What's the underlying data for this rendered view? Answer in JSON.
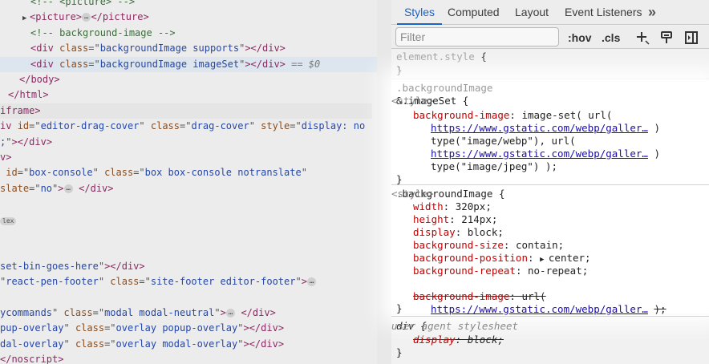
{
  "elements": {
    "lines": [
      {
        "indent": 38,
        "parts": [
          [
            "cmt",
            "<!-- <picture> -->"
          ]
        ]
      },
      {
        "indent": 28,
        "tri": true,
        "parts": [
          [
            "tag",
            "<picture>"
          ],
          [
            "ell",
            "…"
          ],
          [
            "tag",
            "</picture>"
          ]
        ]
      },
      {
        "indent": 38,
        "parts": [
          [
            "cmt",
            "<!-- background-image -->"
          ]
        ]
      },
      {
        "indent": 38,
        "parts": [
          [
            "tag",
            "<div "
          ],
          [
            "attr",
            "class"
          ],
          [
            "eq",
            "=\""
          ],
          [
            "val",
            "backgroundImage supports"
          ],
          [
            "eq",
            "\""
          ],
          [
            "tag",
            "></div>"
          ]
        ]
      },
      {
        "indent": 38,
        "selected": true,
        "parts": [
          [
            "tag",
            "<div "
          ],
          [
            "attr",
            "class"
          ],
          [
            "eq",
            "=\""
          ],
          [
            "val",
            "backgroundImage imageSet"
          ],
          [
            "eq",
            "\""
          ],
          [
            "tag",
            "></div>"
          ],
          [
            "dim",
            " == $0"
          ]
        ]
      },
      {
        "indent": 24,
        "parts": [
          [
            "tag",
            "</body>"
          ]
        ]
      },
      {
        "indent": 10,
        "parts": [
          [
            "tag",
            "</html>"
          ]
        ]
      },
      {
        "indent": 0,
        "tagbg": true,
        "parts": [
          [
            "tag",
            "iframe>"
          ]
        ]
      },
      {
        "indent": 0,
        "parts": [
          [
            "tag",
            "iv "
          ],
          [
            "attr",
            "id"
          ],
          [
            "eq",
            "=\""
          ],
          [
            "val",
            "editor-drag-cover"
          ],
          [
            "eq",
            "\" "
          ],
          [
            "attr",
            "class"
          ],
          [
            "eq",
            "=\""
          ],
          [
            "val",
            "drag-cover"
          ],
          [
            "eq",
            "\" "
          ],
          [
            "attr",
            "style"
          ],
          [
            "eq",
            "=\""
          ],
          [
            "val",
            "display: no"
          ]
        ]
      },
      {
        "indent": 0,
        "parts": [
          [
            "val",
            ";"
          ],
          [
            "eq",
            "\""
          ],
          [
            "tag",
            "></div>"
          ]
        ]
      },
      {
        "indent": 0,
        "parts": [
          [
            "tag",
            "v>"
          ]
        ]
      },
      {
        "indent": 0,
        "parts": [
          [
            "attr",
            " id"
          ],
          [
            "eq",
            "=\""
          ],
          [
            "val",
            "box-console"
          ],
          [
            "eq",
            "\" "
          ],
          [
            "attr",
            "class"
          ],
          [
            "eq",
            "=\""
          ],
          [
            "val",
            "box box-console notranslate"
          ],
          [
            "eq",
            "\""
          ]
        ]
      },
      {
        "indent": 0,
        "parts": [
          [
            "attr",
            "slate"
          ],
          [
            "eq",
            "=\""
          ],
          [
            "val",
            "no"
          ],
          [
            "eq",
            "\""
          ],
          [
            "tag",
            ">"
          ],
          [
            "ell",
            "…"
          ],
          [
            "tag",
            " </div>"
          ]
        ]
      },
      {
        "indent": 0,
        "parts": []
      },
      {
        "indent": 0,
        "badge": "lex",
        "parts": []
      },
      {
        "indent": 0,
        "parts": []
      },
      {
        "indent": 0,
        "parts": []
      },
      {
        "indent": 0,
        "parts": [
          [
            "val",
            "set-bin-goes-here"
          ],
          [
            "eq",
            "\""
          ],
          [
            "tag",
            "></div>"
          ]
        ]
      },
      {
        "indent": 0,
        "parts": [
          [
            "eq",
            "\""
          ],
          [
            "val",
            "react-pen-footer"
          ],
          [
            "eq",
            "\" "
          ],
          [
            "attr",
            "class"
          ],
          [
            "eq",
            "=\""
          ],
          [
            "val",
            "site-footer editor-footer"
          ],
          [
            "eq",
            "\""
          ],
          [
            "tag",
            ">"
          ],
          [
            "ell",
            "…"
          ]
        ]
      },
      {
        "indent": 0,
        "parts": []
      },
      {
        "indent": 0,
        "parts": [
          [
            "val",
            "ycommands"
          ],
          [
            "eq",
            "\" "
          ],
          [
            "attr",
            "class"
          ],
          [
            "eq",
            "=\""
          ],
          [
            "val",
            "modal modal-neutral"
          ],
          [
            "eq",
            "\""
          ],
          [
            "tag",
            ">"
          ],
          [
            "ell",
            "…"
          ],
          [
            "tag",
            " </div>"
          ]
        ]
      },
      {
        "indent": 0,
        "parts": [
          [
            "val",
            "pup-overlay"
          ],
          [
            "eq",
            "\" "
          ],
          [
            "attr",
            "class"
          ],
          [
            "eq",
            "=\""
          ],
          [
            "val",
            "overlay popup-overlay"
          ],
          [
            "eq",
            "\""
          ],
          [
            "tag",
            "></div>"
          ]
        ]
      },
      {
        "indent": 0,
        "parts": [
          [
            "val",
            "dal-overlay"
          ],
          [
            "eq",
            "\" "
          ],
          [
            "attr",
            "class"
          ],
          [
            "eq",
            "=\""
          ],
          [
            "val",
            "overlay modal-overlay"
          ],
          [
            "eq",
            "\""
          ],
          [
            "tag",
            "></div>"
          ]
        ]
      },
      {
        "indent": 0,
        "parts": [
          [
            "tag",
            "</noscript>"
          ]
        ]
      }
    ]
  },
  "tabs": {
    "styles": "Styles",
    "computed": "Computed",
    "layout": "Layout",
    "event_listeners": "Event Listeners",
    "more": "»"
  },
  "toolbar": {
    "filter_placeholder": "Filter",
    "hov": ":hov",
    "cls": ".cls",
    "icons": [
      "new-style-rule-icon",
      "toggle-element-state-icon",
      "computed-sidebar-icon"
    ]
  },
  "rules": {
    "element_style": {
      "selector": "element.style",
      "open": " {",
      "close": "}"
    },
    "imageset": {
      "parent_selector": ".backgroundImage",
      "selector": "&.imageSet",
      "open": " {",
      "origin": "<style>",
      "prop": "background-image",
      "value_start": "image-set( url(",
      "url1": "https://www.gstatic.com/webp/galler…",
      "url1_close": ")",
      "type1": "type(\"image/webp\"), url(",
      "url2": "https://www.gstatic.com/webp/galler…",
      "url2_close": ")",
      "type2": "type(\"image/jpeg\") );",
      "close": "}"
    },
    "background": {
      "selector": ".backgroundImage",
      "open": " {",
      "origin": "<style>",
      "decls": [
        {
          "prop": "width",
          "value": "320px;"
        },
        {
          "prop": "height",
          "value": "214px;"
        },
        {
          "prop": "display",
          "value": "block;"
        },
        {
          "prop": "background-size",
          "value": "contain;"
        },
        {
          "prop": "background-position",
          "value": "center;",
          "tri": true
        },
        {
          "prop": "background-repeat",
          "value": "no-repeat;"
        }
      ],
      "strike_prop": "background-image",
      "strike_value": "url(",
      "strike_url": "https://www.gstatic.com/webp/galler…",
      "strike_close": ");",
      "close": "}"
    },
    "ua": {
      "selector": "div",
      "open": " {",
      "origin": "user agent stylesheet",
      "prop": "display",
      "value": "block;",
      "close": "}"
    }
  },
  "colors": {
    "accent": "#1a64c6",
    "property": "#c80000",
    "link": "#1a0dab"
  }
}
